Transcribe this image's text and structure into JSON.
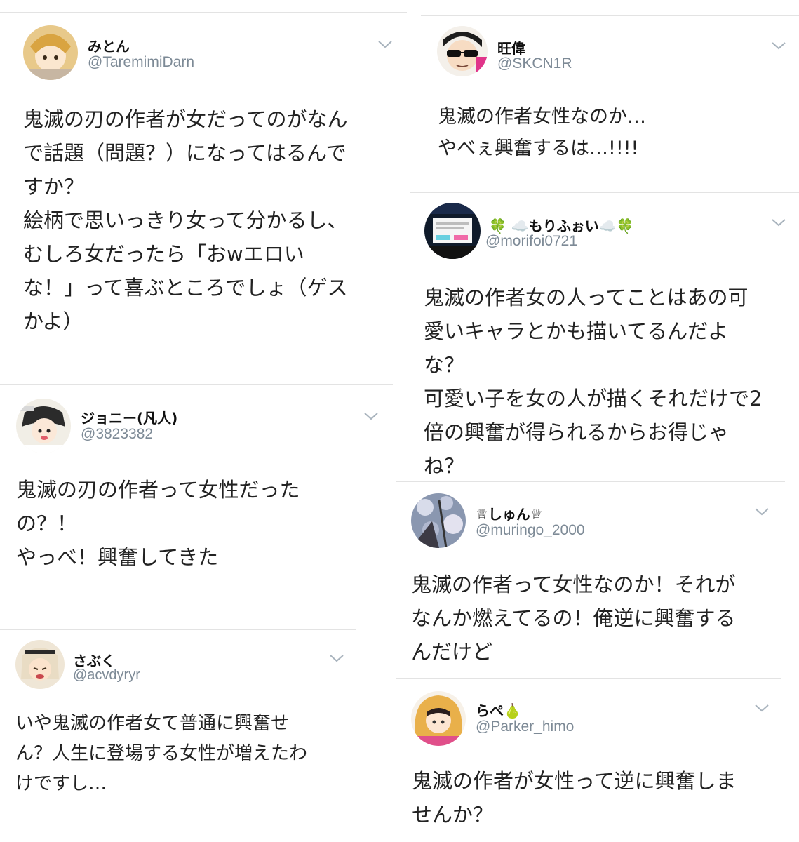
{
  "tweets": [
    {
      "name": "みとん",
      "handle": "@TaremimiDarn",
      "lines": [
        "鬼滅の刃の作者が女だってのがなん",
        "で話題（問題？）になってはるんで",
        "すか？",
        "絵柄で思いっきり女って分かるし、",
        "むしろ女だったら「おwエロい",
        "な！」って喜ぶところでしょ（ゲス",
        "かよ）"
      ]
    },
    {
      "name": "ジョニー(凡人)",
      "handle": "@3823382",
      "lines": [
        "鬼滅の刃の作者って女性だった",
        "の？！",
        "やっべ！興奮してきた"
      ]
    },
    {
      "name": "さぶく",
      "handle": "@acvdyryr",
      "lines": [
        "いや鬼滅の作者女て普通に興奮せ",
        "ん？人生に登場する女性が増えたわ",
        "けですし…"
      ]
    },
    {
      "name": "旺偉",
      "handle": "@SKCN1R",
      "lines": [
        "鬼滅の作者女性なのか…",
        "やべぇ興奮するは…!!!!"
      ]
    },
    {
      "name": "🍀 ☁️もりふぉい☁️🍀",
      "handle": "@morifoi0721",
      "lines": [
        "鬼滅の作者女の人ってことはあの可",
        "愛いキャラとかも描いてるんだよ",
        "な？",
        "可愛い子を女の人が描くそれだけで2",
        "倍の興奮が得られるからお得じゃ",
        "ね？"
      ]
    },
    {
      "name": "♕しゅん♕",
      "handle": "@muringo_2000",
      "lines": [
        "鬼滅の作者って女性なのか！それが",
        "なんか燃えてるの！俺逆に興奮する",
        "んだけど"
      ]
    },
    {
      "name": "らぺ🍐",
      "handle": "@Parker_himo",
      "lines": [
        "鬼滅の作者が女性って逆に興奮しま",
        "せんか？"
      ]
    }
  ]
}
